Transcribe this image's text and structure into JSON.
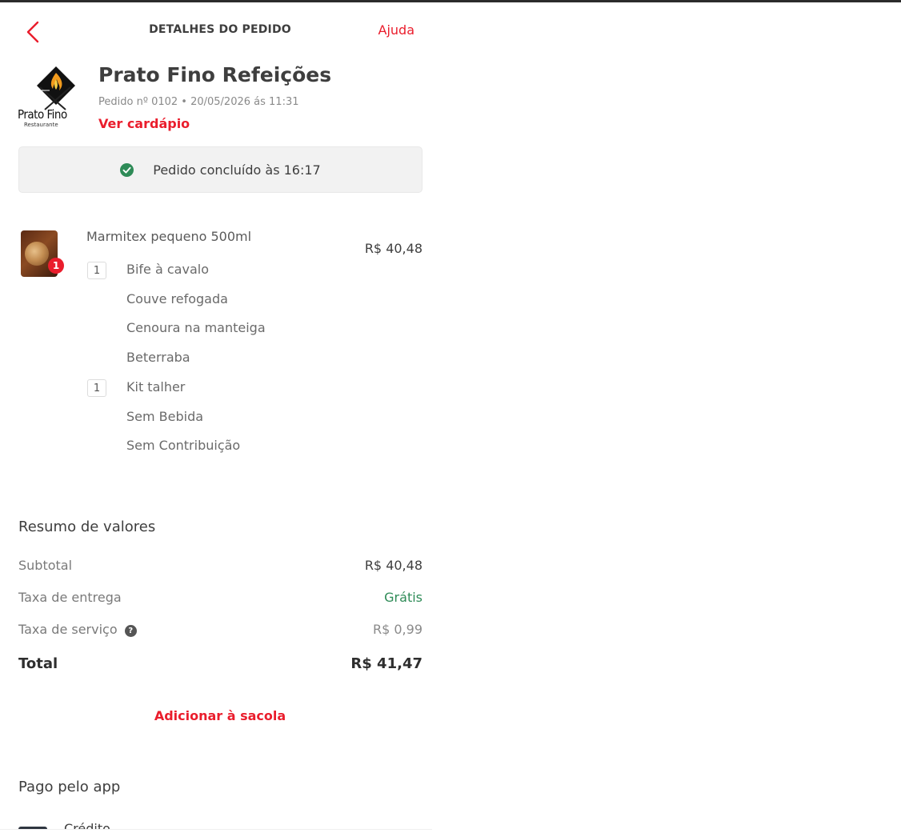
{
  "header": {
    "title": "DETALHES DO PEDIDO",
    "help_label": "Ajuda"
  },
  "restaurant": {
    "logo_text": "Prato Fino",
    "logo_subtext": "Restaurante",
    "name": "Prato Fino Refeições",
    "order_meta": "Pedido nº 0102 • 20/05/2026 ás 11:31",
    "menu_link": "Ver cardápio"
  },
  "status": {
    "text": "Pedido concluído às 16:17",
    "color": "#2e8b57"
  },
  "item": {
    "quantity": "1",
    "name": "Marmitex pequeno 500ml",
    "price": "R$ 40,48",
    "options": [
      {
        "qty": "1",
        "label": "Bife à cavalo"
      },
      {
        "qty": "",
        "label": "Couve refogada"
      },
      {
        "qty": "",
        "label": "Cenoura na manteiga"
      },
      {
        "qty": "",
        "label": "Beterraba"
      },
      {
        "qty": "1",
        "label": "Kit talher"
      },
      {
        "qty": "",
        "label": "Sem Bebida"
      },
      {
        "qty": "",
        "label": "Sem Contribuição"
      }
    ]
  },
  "summary": {
    "title": "Resumo de valores",
    "subtotal_label": "Subtotal",
    "subtotal_value": "R$ 40,48",
    "delivery_label": "Taxa de entrega",
    "delivery_value": "Grátis",
    "service_label": "Taxa de serviço",
    "service_value": "R$ 0,99",
    "total_label": "Total",
    "total_value": "R$ 41,47"
  },
  "actions": {
    "add_to_bag": "Adicionar à sacola"
  },
  "payment": {
    "title": "Pago pelo app",
    "method": "Crédito"
  },
  "colors": {
    "accent": "#ea1d2c",
    "success": "#2e8b57"
  }
}
